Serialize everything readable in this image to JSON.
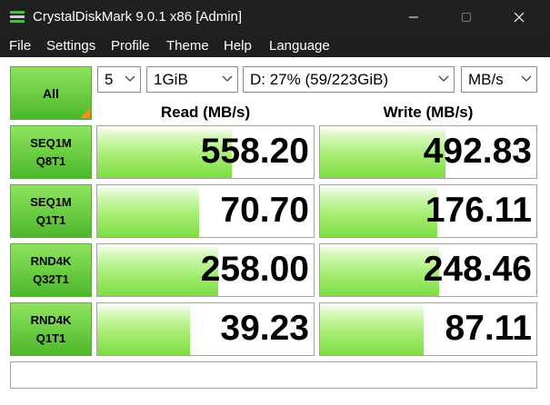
{
  "window": {
    "title": "CrystalDiskMark 9.0.1 x86 [Admin]"
  },
  "menu": [
    "File",
    "Settings",
    "Profile",
    "Theme",
    "Help",
    "Language"
  ],
  "controls": {
    "all_label": "All",
    "count": "5",
    "size": "1GiB",
    "drive": "D: 27% (59/223GiB)",
    "unit": "MB/s"
  },
  "headers": {
    "read": "Read (MB/s)",
    "write": "Write (MB/s)"
  },
  "tests": [
    {
      "line1": "SEQ1M",
      "line2": "Q8T1",
      "read": "558.20",
      "write": "492.83",
      "read_fill": 0.62,
      "write_fill": 0.58
    },
    {
      "line1": "SEQ1M",
      "line2": "Q1T1",
      "read": "70.70",
      "write": "176.11",
      "read_fill": 0.47,
      "write_fill": 0.54
    },
    {
      "line1": "RND4K",
      "line2": "Q32T1",
      "read": "258.00",
      "write": "248.46",
      "read_fill": 0.56,
      "write_fill": 0.55
    },
    {
      "line1": "RND4K",
      "line2": "Q1T1",
      "read": "39.23",
      "write": "87.11",
      "read_fill": 0.43,
      "write_fill": 0.48
    }
  ],
  "comment": "",
  "colors": {
    "accent_green": "#7fdd44",
    "corner_orange": "#ff8a1c",
    "titlebar": "#202020"
  }
}
